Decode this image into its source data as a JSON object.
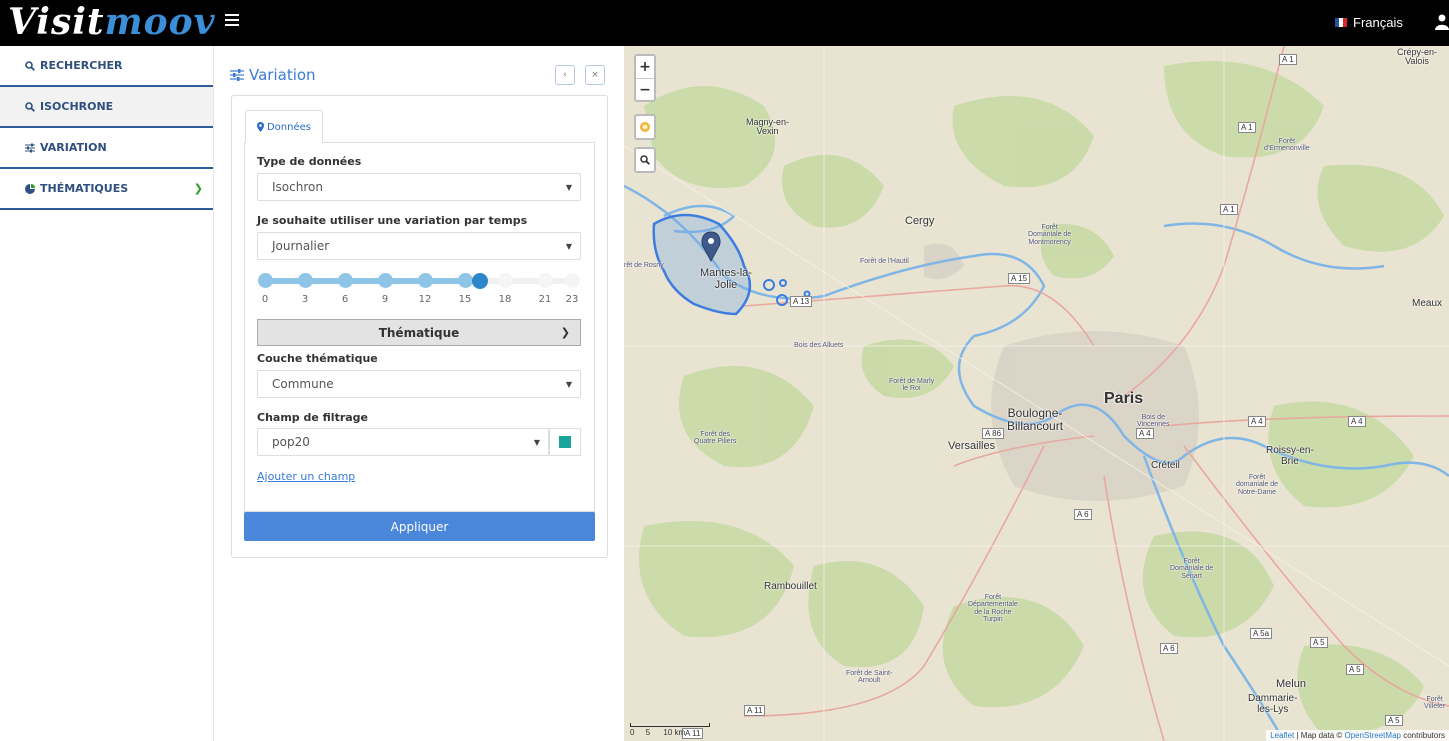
{
  "header": {
    "logo_main": "Visit",
    "logo_accent": "moov",
    "language": "Français"
  },
  "sidebar": {
    "items": [
      {
        "label": "RECHERCHER",
        "icon": "search-icon"
      },
      {
        "label": "ISOCHRONE",
        "icon": "search-icon"
      },
      {
        "label": "VARIATION",
        "icon": "sliders-icon"
      },
      {
        "label": "THÉMATIQUES",
        "icon": "pie-chart-icon"
      }
    ]
  },
  "panel": {
    "title": "Variation",
    "prev_label": "‹",
    "close_label": "×",
    "tab_label": "Données",
    "data_type_label": "Type de données",
    "data_type_value": "Isochron",
    "variation_label": "Je souhaite utiliser une variation par temps",
    "variation_value": "Journalier",
    "slider": {
      "ticks": [
        "0",
        "3",
        "6",
        "9",
        "12",
        "15",
        "18",
        "21",
        "23"
      ],
      "min": 0,
      "max": 23,
      "value": 16
    },
    "thematic_button": "Thématique",
    "layer_label": "Couche thématique",
    "layer_value": "Commune",
    "filter_label": "Champ de filtrage",
    "filter_value": "pop20",
    "filter_color": "#1aa59a",
    "add_field": "Ajouter un champ",
    "apply": "Appliquer"
  },
  "map": {
    "zoom_in": "+",
    "zoom_out": "−",
    "places": {
      "paris": "Paris",
      "boulogne": "Boulogne-\nBillancourt",
      "versailles": "Versailles",
      "cergy": "Cergy",
      "mantes": "Mantes-la-\nJolie",
      "magny": "Magny-en-\nVexin",
      "rambouillet": "Rambouillet",
      "creteil": "Créteil",
      "roissy": "Roissy-en-\nBrie",
      "melun": "Melun",
      "dammarie": "Dammarie-\nles-Lys",
      "meaux": "Meaux",
      "crepy": "Crépy-en-\nValois",
      "foret_montmorency": "Forêt\nDomaniale de\nMontmorency",
      "foret_hautil": "Forêt de l'Hautil",
      "bois_alluets": "Bois des Alluets",
      "foret_marly": "Forêt de Marly\nle Roi",
      "foret_quatre": "Forêt des\nQuatre Piliers",
      "bois_vincennes": "Bois de\nVincennes",
      "foret_ermenonville": "Forêt\nd'Ermenonville",
      "foret_notre_dame": "Forêt\ndomaniale de\nNotre-Dame",
      "foret_senart": "Forêt\nDomaniale de\nSénart",
      "foret_roche": "Forêt\nDépartementale\nde la Roche\nTurpin",
      "foret_arnoult": "Forêt de Saint-\nArnoult",
      "foret_rosny": "rêt de Rosny",
      "foret_villefer": "Forêt\nVillefer"
    },
    "roads": [
      "A 1",
      "A 1",
      "A 1",
      "A 15",
      "A 13",
      "A 86",
      "A 4",
      "A 4",
      "A 4",
      "A 6",
      "A 6",
      "A 5a",
      "A 5",
      "A 5",
      "A 5",
      "A 11",
      "A 11"
    ],
    "scale_left": "0",
    "scale_mid": "5",
    "scale_right": "10 km",
    "attribution_leaflet": "Leaflet",
    "attribution_text": " | Map data © ",
    "attribution_osm": "OpenStreetMap",
    "attribution_tail": " contributors"
  }
}
